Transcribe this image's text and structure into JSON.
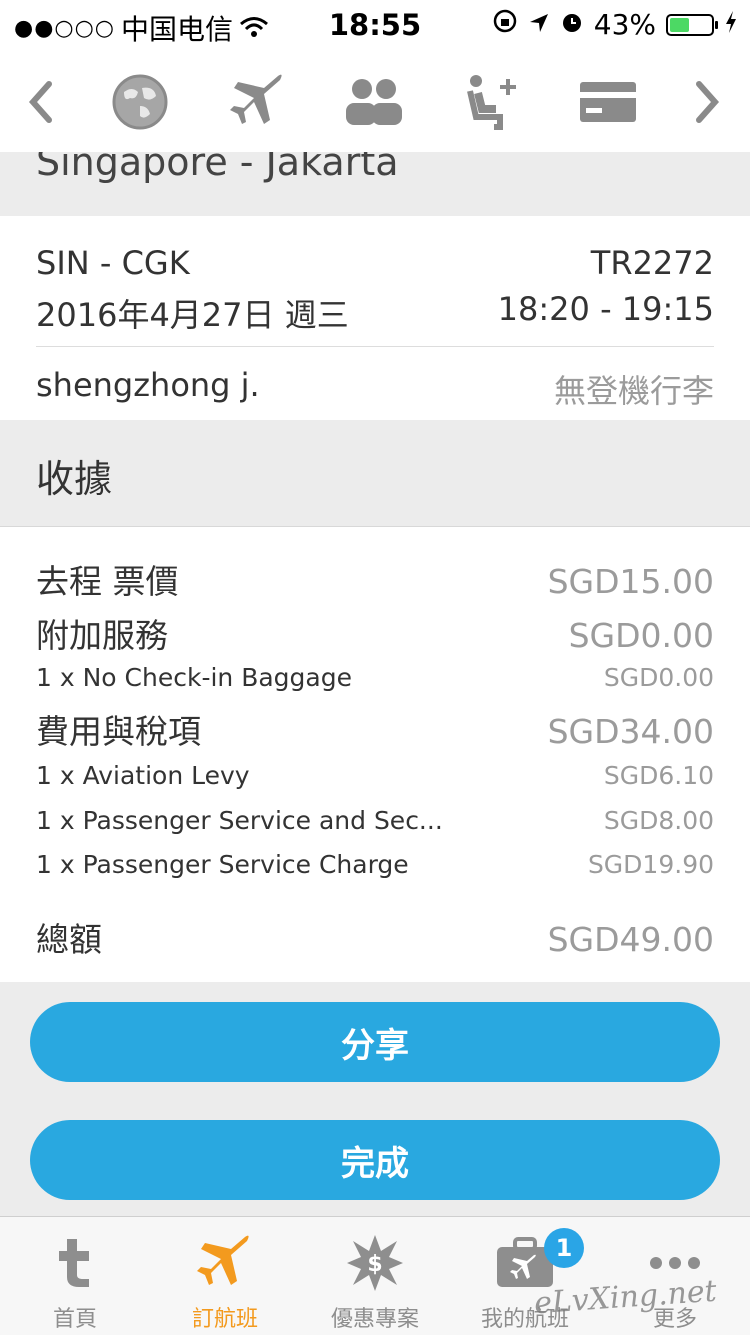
{
  "status_bar": {
    "signal_dots": "●●○○○",
    "carrier": "中国电信",
    "time": "18:55",
    "battery": "43%",
    "icons": [
      "wifi-icon",
      "rotation-lock-icon",
      "location-icon",
      "alarm-icon",
      "battery-icon",
      "charging-icon"
    ]
  },
  "step_nav": {
    "icons": [
      "back-chevron-icon",
      "globe-icon",
      "airplane-icon",
      "passengers-icon",
      "seat-add-icon",
      "credit-card-icon",
      "forward-chevron-icon"
    ]
  },
  "route_title": "Singapore - Jakarta",
  "flight": {
    "route_code": "SIN - CGK",
    "flight_no": "TR2272",
    "date": "2016年4月27日 週三",
    "time": "18:20 - 19:15",
    "passenger": "shengzhong j.",
    "baggage": "無登機行李"
  },
  "receipt": {
    "header": "收據",
    "lines": [
      {
        "label": "去程 票價",
        "value": "SGD15.00",
        "level": 1
      },
      {
        "label": "附加服務",
        "value": "SGD0.00",
        "level": 1
      },
      {
        "label": "1 x No Check-in Baggage",
        "value": "SGD0.00",
        "level": 2
      },
      {
        "label": "費用與稅項",
        "value": "SGD34.00",
        "level": 1
      },
      {
        "label": "1 x Aviation Levy",
        "value": "SGD6.10",
        "level": 2
      },
      {
        "label": "1 x Passenger Service and Sec...",
        "value": "SGD8.00",
        "level": 2
      },
      {
        "label": "1 x Passenger Service Charge",
        "value": "SGD19.90",
        "level": 2
      }
    ],
    "total_label": "總額",
    "total_value": "SGD49.00"
  },
  "buttons": {
    "share": "分享",
    "done": "完成"
  },
  "tab_bar": {
    "items": [
      {
        "label": "首頁",
        "icon": "t-logo-icon"
      },
      {
        "label": "訂航班",
        "icon": "airplane-icon",
        "active": true
      },
      {
        "label": "優惠專案",
        "icon": "promo-star-icon"
      },
      {
        "label": "我的航班",
        "icon": "briefcase-plane-icon",
        "badge": "1"
      },
      {
        "label": "更多",
        "icon": "more-dots-icon"
      }
    ]
  },
  "watermark": "eLvXing.net",
  "colors": {
    "accent": "#29a8e0",
    "active_tab": "#f39a1e",
    "muted": "#9b9b9b"
  }
}
